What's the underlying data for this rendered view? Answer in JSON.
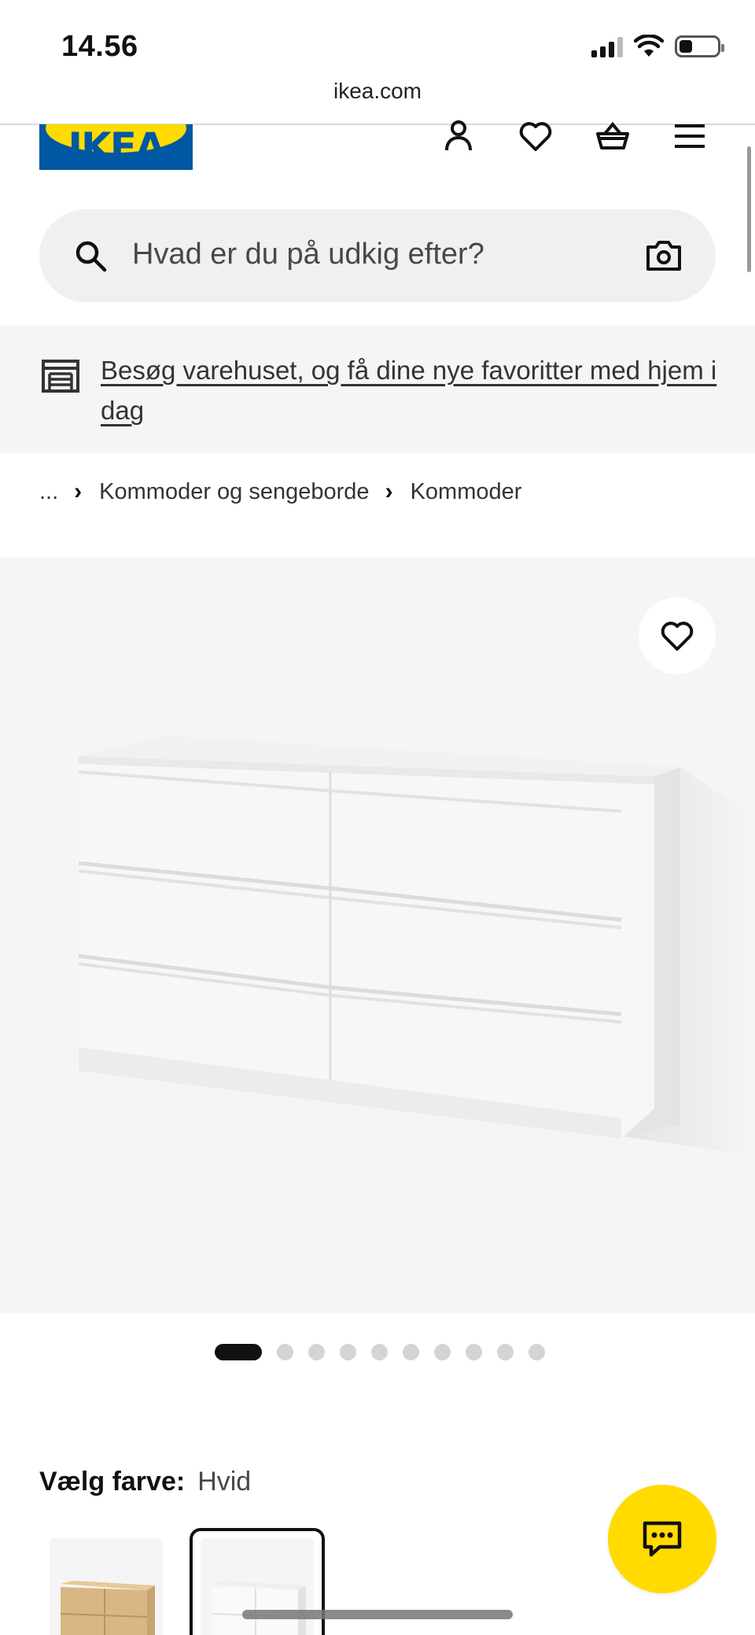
{
  "status_bar": {
    "time": "14.56",
    "battery_percent": 35
  },
  "browser": {
    "url": "ikea.com"
  },
  "header": {
    "logo_text": "IKEA",
    "icons": [
      "account-icon",
      "heart-icon",
      "basket-icon",
      "menu-icon"
    ]
  },
  "search": {
    "placeholder": "Hvad er du på udkig efter?",
    "left_icon": "search-icon",
    "right_icon": "camera-icon"
  },
  "banner": {
    "icon": "store-icon",
    "link_text": "Besøg varehuset, og få dine nye favoritter med hjem i dag"
  },
  "breadcrumb": {
    "items": [
      "...",
      "Kommoder og sengeborde",
      "Kommoder"
    ],
    "separator": "›"
  },
  "gallery": {
    "image_count": 10,
    "active_index": 0
  },
  "colors": {
    "brand_blue": "#0058a3",
    "brand_yellow": "#ffdb00"
  },
  "color_choice": {
    "label": "Vælg farve:",
    "selected": "Hvid",
    "selected_index": 1
  },
  "chat": {
    "icon": "chat-icon"
  }
}
